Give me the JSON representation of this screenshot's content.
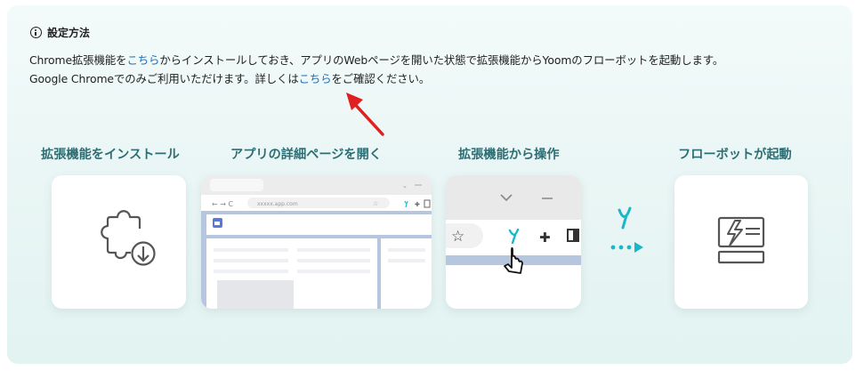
{
  "header": {
    "icon": "info-icon",
    "title": "設定方法"
  },
  "description": {
    "line1_a": "Chrome拡張機能を",
    "line1_link": "こちら",
    "line1_b": "からインストールしておき、アプリのWebページを開いた状態で拡張機能からYoomのフローボットを起動します。",
    "line2_a": "Google Chromeでのみご利用いただけます。詳しくは",
    "line2_link": "こちら",
    "line2_b": "をご確認ください。"
  },
  "steps": [
    {
      "title": "拡張機能をインストール",
      "icon": "puzzle-download-icon"
    },
    {
      "title": "アプリの詳細ページを開く",
      "icon": "browser-window-icon"
    },
    {
      "title": "拡張機能から操作",
      "icon": "extension-toolbar-icon"
    },
    {
      "title": "フローボットが起動",
      "icon": "flowbot-launch-icon"
    }
  ],
  "browser_mock": {
    "url": "xxxxx.app.com"
  },
  "colors": {
    "accent": "#2c6e73",
    "link": "#1f6fb8",
    "arrow": "#e02020",
    "yoom": "#19b8c8",
    "bar": "#b6c6df"
  }
}
